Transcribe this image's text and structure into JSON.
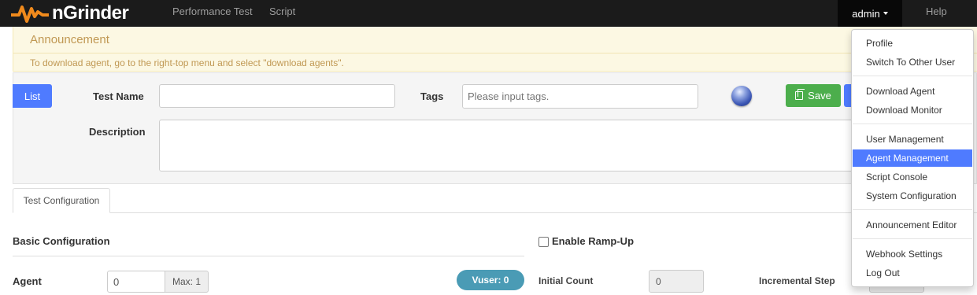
{
  "navbar": {
    "brand": "nGrinder",
    "links": [
      "Performance Test",
      "Script"
    ],
    "user": "admin",
    "help": "Help"
  },
  "announcement": {
    "title": "Announcement",
    "text": "To download agent, go to the right-top menu and select \"download agents\"."
  },
  "form": {
    "list_button": "List",
    "test_name_label": "Test Name",
    "test_name_value": "",
    "tags_label": "Tags",
    "tags_placeholder": "Please input tags.",
    "save_button": "Save",
    "description_label": "Description",
    "description_value": ""
  },
  "tabs": [
    "Test Configuration"
  ],
  "basic_config": {
    "title": "Basic Configuration",
    "agent_label": "Agent",
    "agent_value": "0",
    "agent_max": "Max: 1",
    "vuser_badge": "Vuser: 0"
  },
  "ramp_up": {
    "label": "Enable Ramp-Up",
    "checked": false,
    "initial_count_label": "Initial Count",
    "initial_count_value": "0",
    "incremental_step_label": "Incremental Step"
  },
  "user_menu": {
    "groups": [
      [
        "Profile",
        "Switch To Other User"
      ],
      [
        "Download Agent",
        "Download Monitor"
      ],
      [
        "User Management",
        "Agent Management",
        "Script Console",
        "System Configuration"
      ],
      [
        "Announcement Editor"
      ],
      [
        "Webhook Settings",
        "Log Out"
      ]
    ],
    "active_item": "Agent Management"
  },
  "colors": {
    "navbar": "#1b1b1b",
    "primary": "#4f7bff",
    "success": "#4cae4c",
    "vuser_badge": "#4a9bb5",
    "logo_orange": "#f08a1c"
  }
}
